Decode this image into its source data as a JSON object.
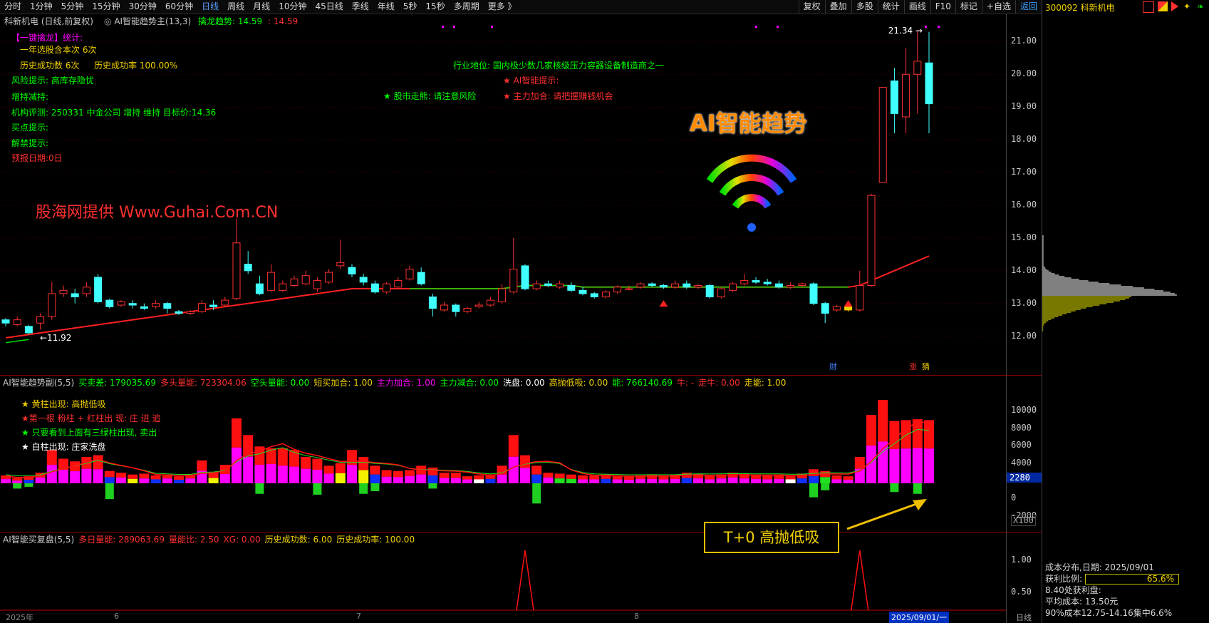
{
  "toolbar": {
    "periods": [
      "分时",
      "1分钟",
      "5分钟",
      "15分钟",
      "30分钟",
      "60分钟",
      "日线",
      "周线",
      "月线",
      "10分钟",
      "45日线",
      "季线",
      "年线",
      "5秒",
      "15秒",
      "多周期",
      "更多 》"
    ],
    "active": "日线",
    "tools": [
      "复权",
      "叠加",
      "多股",
      "统计",
      "画线",
      "F10",
      "标记",
      "+自选",
      "返回"
    ]
  },
  "stock": {
    "code_name": "300092 科新机电"
  },
  "main": {
    "title": "科新机电 (日线,前复权)",
    "indicator": "AI智能趋势主(13,3)",
    "trend_label": "擒龙趋势: 14.59",
    "trend_value": "14.59",
    "stats_title": "【一键擒龙】统计:",
    "stats": [
      "一年选股含本次 6次",
      "历史成功数 6次",
      "历史成功率 100.00%"
    ],
    "left_lines": [
      "风险提示: 高库存隐忧",
      "增持减持:",
      "机构评测: 250331 中金公司 增持 维持 目标价:14.36",
      "买点提示:",
      "解禁提示:",
      "预报日期:0日"
    ],
    "industry": "行业地位: 国内极少数几家核级压力容器设备制造商之一",
    "market_tip": "★ 股市走熊: 请注意风险",
    "ai_tip": "★ AI智能提示:",
    "main_tip": "★ 主力加合: 请把握赚钱机会",
    "watermark": "股海网提供 Www.Guhai.Com.CN",
    "ai_title": "AI智能趋势",
    "high_label": "21.34",
    "low_label": "11.92",
    "tags": [
      "财",
      "涨",
      "猜"
    ],
    "yaxis": [
      "21.00",
      "20.00",
      "19.00",
      "18.00",
      "17.00",
      "16.00",
      "15.00",
      "14.00",
      "13.00",
      "12.00"
    ]
  },
  "sub1": {
    "header": [
      {
        "t": "AI智能趋势副(5,5)",
        "c": "#c8c8c8"
      },
      {
        "t": "买卖差: 179035.69",
        "c": "#00ff00"
      },
      {
        "t": "多头量能: 723304.06",
        "c": "#ff3030"
      },
      {
        "t": "空头量能: 0.00",
        "c": "#00ff00"
      },
      {
        "t": "短买加合: 1.00",
        "c": "#f0d000"
      },
      {
        "t": "主力加合: 1.00",
        "c": "#ff00ff"
      },
      {
        "t": "主力减合: 0.00",
        "c": "#00ff00"
      },
      {
        "t": "洗盘: 0.00",
        "c": "#ffffff"
      },
      {
        "t": "高抛低吸: 0.00",
        "c": "#f0d000"
      },
      {
        "t": "能: 766140.69",
        "c": "#00ff00"
      },
      {
        "t": "牛: -",
        "c": "#ff3030"
      },
      {
        "t": "走牛: 0.00",
        "c": "#ff3030"
      },
      {
        "t": "走能: 1.00",
        "c": "#f0d000"
      }
    ],
    "legend": [
      "★ 黄柱出现: 高抛低吸",
      "★第一根 粉柱 + 红柱出 现: 庄 进 追",
      "★ 只要看到上面有三绿柱出现, 卖出",
      "★ 白柱出现:  庄家洗盘"
    ],
    "yaxis": [
      "10000",
      "8000",
      "6000",
      "4000",
      "2000",
      "0",
      "-2000"
    ],
    "current": "2280",
    "mult": "X100"
  },
  "sub2": {
    "header": [
      {
        "t": "AI智能买复盘(5,5)",
        "c": "#c8c8c8"
      },
      {
        "t": "多日量能: 289063.69",
        "c": "#ff3030"
      },
      {
        "t": "量能比: 2.50",
        "c": "#ff3030"
      },
      {
        "t": "XG: 0.00",
        "c": "#ff3030"
      },
      {
        "t": "历史成功数: 6.00",
        "c": "#f0d000"
      },
      {
        "t": "历史成功率: 100.00",
        "c": "#f0d000"
      }
    ],
    "yaxis": [
      "1.00",
      "0.50"
    ],
    "callout": "T+0 高抛低吸"
  },
  "bottom": {
    "dates": [
      "2025年",
      "6",
      "7",
      "8"
    ],
    "cursor_date": "2025/09/01/一",
    "period": "日线"
  },
  "cost": {
    "title": "成本分布,日期: 2025/09/01",
    "ratio_label": "获利比例:",
    "ratio": "65.6%",
    "profit_line": "8.40处获利盘:",
    "avg": "平均成本: 13.50元",
    "c90": "90%成本12.75-14.16集中6.6%"
  },
  "chart_data": {
    "type": "candlestick",
    "candles": [
      [
        12.5,
        12.4,
        12.55,
        12.3
      ],
      [
        12.35,
        12.5,
        12.6,
        12.3
      ],
      [
        12.3,
        12.1,
        12.35,
        12.05
      ],
      [
        12.4,
        12.6,
        12.7,
        12.2
      ],
      [
        12.6,
        13.3,
        13.65,
        12.5
      ],
      [
        13.3,
        13.4,
        13.55,
        13.2
      ],
      [
        13.3,
        13.2,
        13.45,
        13.0
      ],
      [
        13.3,
        13.5,
        13.65,
        13.2
      ],
      [
        13.8,
        13.05,
        13.9,
        13.0
      ],
      [
        13.1,
        12.9,
        13.15,
        12.85
      ],
      [
        12.95,
        13.05,
        13.1,
        12.9
      ],
      [
        13.0,
        12.95,
        13.1,
        12.85
      ],
      [
        12.9,
        12.85,
        13.0,
        12.8
      ],
      [
        12.9,
        13.0,
        13.1,
        12.85
      ],
      [
        13.0,
        12.85,
        13.05,
        12.7
      ],
      [
        12.75,
        12.7,
        12.8,
        12.65
      ],
      [
        12.7,
        12.75,
        12.8,
        12.65
      ],
      [
        12.75,
        13.0,
        13.1,
        12.7
      ],
      [
        12.95,
        12.9,
        13.1,
        12.8
      ],
      [
        12.95,
        13.1,
        13.2,
        12.9
      ],
      [
        13.15,
        14.85,
        15.6,
        13.1
      ],
      [
        14.2,
        14.0,
        14.6,
        13.9
      ],
      [
        13.6,
        13.3,
        13.85,
        13.25
      ],
      [
        13.4,
        13.95,
        14.2,
        13.35
      ],
      [
        13.4,
        13.6,
        13.7,
        13.35
      ],
      [
        13.55,
        13.75,
        13.85,
        13.5
      ],
      [
        13.6,
        13.85,
        14.0,
        13.55
      ],
      [
        13.45,
        13.7,
        13.8,
        13.35
      ],
      [
        13.65,
        13.95,
        14.05,
        13.6
      ],
      [
        14.15,
        14.25,
        14.95,
        14.05
      ],
      [
        14.1,
        13.9,
        14.2,
        13.8
      ],
      [
        13.8,
        13.65,
        13.9,
        13.55
      ],
      [
        13.6,
        13.35,
        13.7,
        13.3
      ],
      [
        13.35,
        13.6,
        13.65,
        13.3
      ],
      [
        13.5,
        13.7,
        13.8,
        13.45
      ],
      [
        13.75,
        14.05,
        14.15,
        13.7
      ],
      [
        13.95,
        13.6,
        14.1,
        13.55
      ],
      [
        13.2,
        12.85,
        13.3,
        12.6
      ],
      [
        12.8,
        12.95,
        13.05,
        12.75
      ],
      [
        12.95,
        12.75,
        13.0,
        12.6
      ],
      [
        12.75,
        12.85,
        12.9,
        12.7
      ],
      [
        12.9,
        12.95,
        13.05,
        12.85
      ],
      [
        12.95,
        13.1,
        13.2,
        12.9
      ],
      [
        13.05,
        13.45,
        13.6,
        13.0
      ],
      [
        13.35,
        14.05,
        15.0,
        13.3
      ],
      [
        14.15,
        13.45,
        14.2,
        13.4
      ],
      [
        13.45,
        13.6,
        13.7,
        13.4
      ],
      [
        13.6,
        13.55,
        13.7,
        13.5
      ],
      [
        13.5,
        13.6,
        13.7,
        13.45
      ],
      [
        13.55,
        13.4,
        13.65,
        13.35
      ],
      [
        13.4,
        13.3,
        13.5,
        13.25
      ],
      [
        13.3,
        13.2,
        13.35,
        13.15
      ],
      [
        13.2,
        13.35,
        13.4,
        13.15
      ],
      [
        13.35,
        13.5,
        13.55,
        13.3
      ],
      [
        13.45,
        13.45,
        13.55,
        13.4
      ],
      [
        13.5,
        13.6,
        13.65,
        13.45
      ],
      [
        13.6,
        13.55,
        13.65,
        13.5
      ],
      [
        13.55,
        13.5,
        13.6,
        13.45
      ],
      [
        13.5,
        13.6,
        13.7,
        13.45
      ],
      [
        13.6,
        13.5,
        13.7,
        13.45
      ],
      [
        13.5,
        13.55,
        13.6,
        13.45
      ],
      [
        13.55,
        13.2,
        13.6,
        13.15
      ],
      [
        13.2,
        13.45,
        13.5,
        13.15
      ],
      [
        13.4,
        13.6,
        13.65,
        13.35
      ],
      [
        13.6,
        13.7,
        13.9,
        13.55
      ],
      [
        13.7,
        13.65,
        13.8,
        13.6
      ],
      [
        13.65,
        13.6,
        13.75,
        13.55
      ],
      [
        13.6,
        13.5,
        13.7,
        13.45
      ],
      [
        13.5,
        13.55,
        13.65,
        13.45
      ],
      [
        13.55,
        13.6,
        13.65,
        13.5
      ],
      [
        13.6,
        13.0,
        13.65,
        12.95
      ],
      [
        13.0,
        12.7,
        13.05,
        12.4
      ],
      [
        12.8,
        12.9,
        12.95,
        12.75
      ],
      [
        12.9,
        12.8,
        13.0,
        12.75
      ],
      [
        12.8,
        13.55,
        14.0,
        12.75
      ],
      [
        13.55,
        16.3,
        16.35,
        13.5
      ],
      [
        16.7,
        19.6,
        19.6,
        16.7
      ],
      [
        19.8,
        18.8,
        20.2,
        18.2
      ],
      [
        18.7,
        20.0,
        20.8,
        18.2
      ],
      [
        20.0,
        20.4,
        21.34,
        18.8
      ],
      [
        20.35,
        19.1,
        21.3,
        18.2
      ]
    ],
    "ma_red": [
      11.95,
      12.0,
      12.05,
      12.1,
      12.15,
      12.2,
      12.25,
      12.3,
      12.35,
      12.4,
      12.45,
      12.5,
      12.55,
      12.6,
      12.65,
      12.7,
      12.75,
      12.8,
      12.85,
      12.9,
      12.95,
      13.0,
      13.05,
      13.1,
      13.15,
      13.2,
      13.25,
      13.3,
      13.35,
      13.4,
      13.45,
      13.45,
      13.45,
      13.45,
      13.45,
      13.45,
      13.45,
      13.45,
      13.45,
      13.45,
      13.45,
      13.45,
      13.45,
      13.45,
      13.5,
      13.55,
      13.55,
      13.55,
      13.55,
      13.55,
      13.5,
      13.5,
      13.5,
      13.5,
      13.5,
      13.5,
      13.5,
      13.5,
      13.5,
      13.5,
      13.5,
      13.5,
      13.5,
      13.5,
      13.5,
      13.5,
      13.5,
      13.5,
      13.5,
      13.5,
      13.5,
      13.5,
      13.5,
      13.5,
      13.55,
      13.7,
      13.85,
      14.0,
      14.15,
      14.3,
      14.45
    ],
    "vol_bars": [
      {
        "v": 900,
        "c": "r"
      },
      {
        "v": 600,
        "c": "m"
      },
      {
        "v": 800,
        "c": "b"
      },
      {
        "v": 1200,
        "c": "r"
      },
      {
        "v": 3800,
        "c": "r"
      },
      {
        "v": 2800,
        "c": "r"
      },
      {
        "v": 2500,
        "c": "r"
      },
      {
        "v": 3000,
        "c": "r"
      },
      {
        "v": 3200,
        "c": "m"
      },
      {
        "v": 1400,
        "c": "b"
      },
      {
        "v": 1200,
        "c": "r"
      },
      {
        "v": 1000,
        "c": "y"
      },
      {
        "v": 1100,
        "c": "m"
      },
      {
        "v": 900,
        "c": "b"
      },
      {
        "v": 1000,
        "c": "r"
      },
      {
        "v": 800,
        "c": "b"
      },
      {
        "v": 1000,
        "c": "r"
      },
      {
        "v": 2600,
        "c": "r"
      },
      {
        "v": 1200,
        "c": "y"
      },
      {
        "v": 2100,
        "c": "m"
      },
      {
        "v": 7400,
        "c": "r"
      },
      {
        "v": 5500,
        "c": "r"
      },
      {
        "v": 4200,
        "c": "m"
      },
      {
        "v": 4000,
        "c": "r"
      },
      {
        "v": 4000,
        "c": "m"
      },
      {
        "v": 3800,
        "c": "m"
      },
      {
        "v": 3000,
        "c": "r"
      },
      {
        "v": 2800,
        "c": "r"
      },
      {
        "v": 2000,
        "c": "r"
      },
      {
        "v": 2300,
        "c": "y"
      },
      {
        "v": 3800,
        "c": "r"
      },
      {
        "v": 3000,
        "c": "y"
      },
      {
        "v": 2000,
        "c": "b"
      },
      {
        "v": 1500,
        "c": "m"
      },
      {
        "v": 1400,
        "c": "m"
      },
      {
        "v": 1500,
        "c": "r"
      },
      {
        "v": 2000,
        "c": "m"
      },
      {
        "v": 1800,
        "c": "b"
      },
      {
        "v": 1200,
        "c": "m"
      },
      {
        "v": 1200,
        "c": "m"
      },
      {
        "v": 800,
        "c": "r"
      },
      {
        "v": 900,
        "c": "w"
      },
      {
        "v": 1000,
        "c": "b"
      },
      {
        "v": 2000,
        "c": "m"
      },
      {
        "v": 5500,
        "c": "r"
      },
      {
        "v": 3200,
        "c": "r"
      },
      {
        "v": 2000,
        "c": "b"
      },
      {
        "v": 1200,
        "c": "r"
      },
      {
        "v": 1100,
        "c": "g"
      },
      {
        "v": 1000,
        "c": "g"
      },
      {
        "v": 900,
        "c": "m"
      },
      {
        "v": 900,
        "c": "m"
      },
      {
        "v": 1000,
        "c": "b"
      },
      {
        "v": 900,
        "c": "m"
      },
      {
        "v": 800,
        "c": "m"
      },
      {
        "v": 900,
        "c": "r"
      },
      {
        "v": 1000,
        "c": "m"
      },
      {
        "v": 900,
        "c": "m"
      },
      {
        "v": 1000,
        "c": "m"
      },
      {
        "v": 1200,
        "c": "b"
      },
      {
        "v": 1100,
        "c": "m"
      },
      {
        "v": 900,
        "c": "m"
      },
      {
        "v": 1000,
        "c": "r"
      },
      {
        "v": 1200,
        "c": "r"
      },
      {
        "v": 1100,
        "c": "m"
      },
      {
        "v": 1000,
        "c": "m"
      },
      {
        "v": 900,
        "c": "m"
      },
      {
        "v": 1000,
        "c": "m"
      },
      {
        "v": 900,
        "c": "w"
      },
      {
        "v": 1100,
        "c": "b"
      },
      {
        "v": 1600,
        "c": "b"
      },
      {
        "v": 1400,
        "c": "g"
      },
      {
        "v": 900,
        "c": "m"
      },
      {
        "v": 800,
        "c": "m"
      },
      {
        "v": 3000,
        "c": "r"
      },
      {
        "v": 7800,
        "c": "r"
      },
      {
        "v": 9500,
        "c": "m"
      },
      {
        "v": 7100,
        "c": "r"
      },
      {
        "v": 7200,
        "c": "r"
      },
      {
        "v": 7300,
        "c": "r"
      },
      {
        "v": 7200,
        "c": "r"
      }
    ],
    "neg_bars": [
      0,
      -600,
      -400,
      0,
      0,
      0,
      0,
      0,
      0,
      -1800,
      0,
      0,
      0,
      0,
      0,
      0,
      0,
      0,
      0,
      0,
      0,
      0,
      -1200,
      0,
      0,
      0,
      0,
      -1300,
      0,
      0,
      0,
      -1200,
      -900,
      0,
      0,
      0,
      0,
      -600,
      0,
      0,
      0,
      0,
      0,
      0,
      0,
      0,
      -2300,
      0,
      0,
      0,
      0,
      0,
      0,
      0,
      0,
      0,
      0,
      0,
      0,
      0,
      0,
      0,
      0,
      0,
      0,
      0,
      0,
      0,
      0,
      0,
      -1600,
      -800,
      0,
      0,
      0,
      0,
      0,
      -1000,
      0,
      -1200,
      0
    ],
    "sub2_spikes": [
      45,
      74
    ],
    "signals": [
      57,
      73
    ]
  }
}
